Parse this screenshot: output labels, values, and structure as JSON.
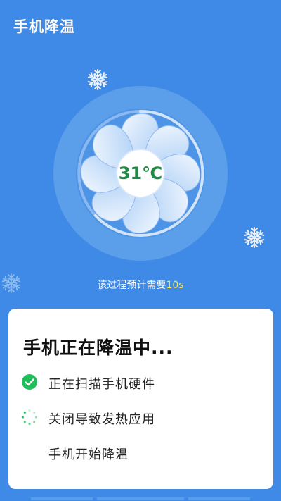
{
  "header": {
    "title": "手机降温"
  },
  "fan": {
    "temperature": "31℃"
  },
  "estimate": {
    "prefix": "该过程预计需要",
    "time": "10s"
  },
  "card": {
    "title": "手机正在降温中...",
    "steps": [
      {
        "label": "正在扫描手机硬件",
        "status": "done",
        "icon": "check-icon"
      },
      {
        "label": "关闭导致发热应用",
        "status": "loading",
        "icon": "spinner-icon"
      },
      {
        "label": "手机开始降温",
        "status": "pending",
        "icon": ""
      }
    ]
  },
  "colors": {
    "background": "#3f8ae6",
    "accent_green": "#1fbe5a",
    "time_highlight": "#f7e84a",
    "temperature_text": "#1f8a44"
  }
}
